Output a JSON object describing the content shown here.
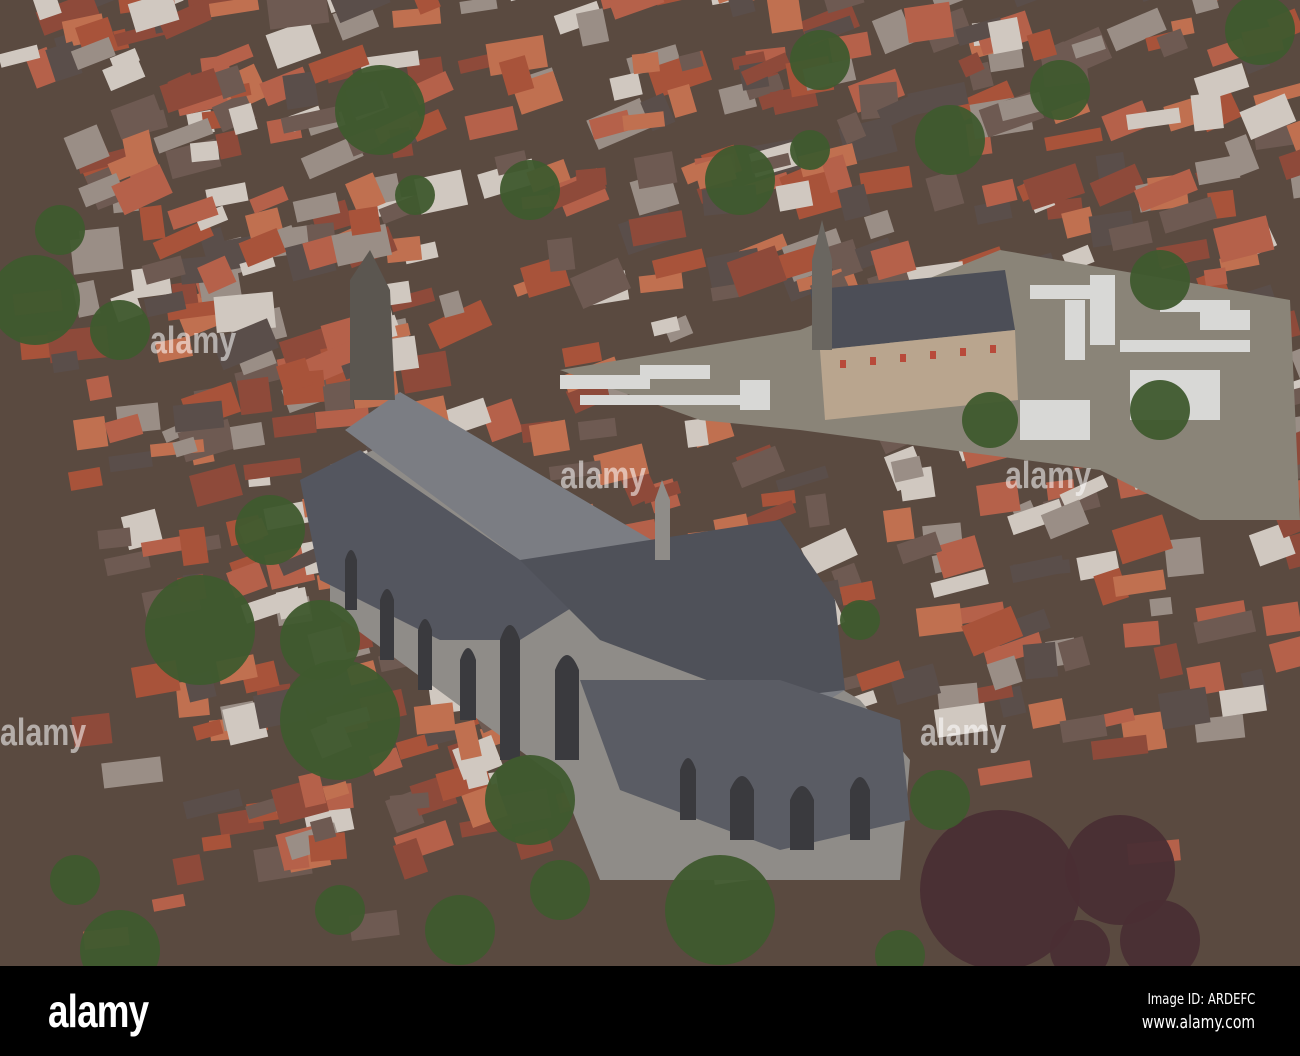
{
  "photo": {
    "subject": "aerial-church-town",
    "colors": {
      "roof_red": "#a8533a",
      "slate": "#5e6068",
      "stone": "#8d8a86",
      "tree": "#3f5a2e",
      "stall": "#d8d8d6"
    }
  },
  "watermark": {
    "text": "alamy"
  },
  "footer": {
    "logo": "alamy",
    "image_id": "Image ID: ARDEFC",
    "site": "www.alamy.com"
  }
}
